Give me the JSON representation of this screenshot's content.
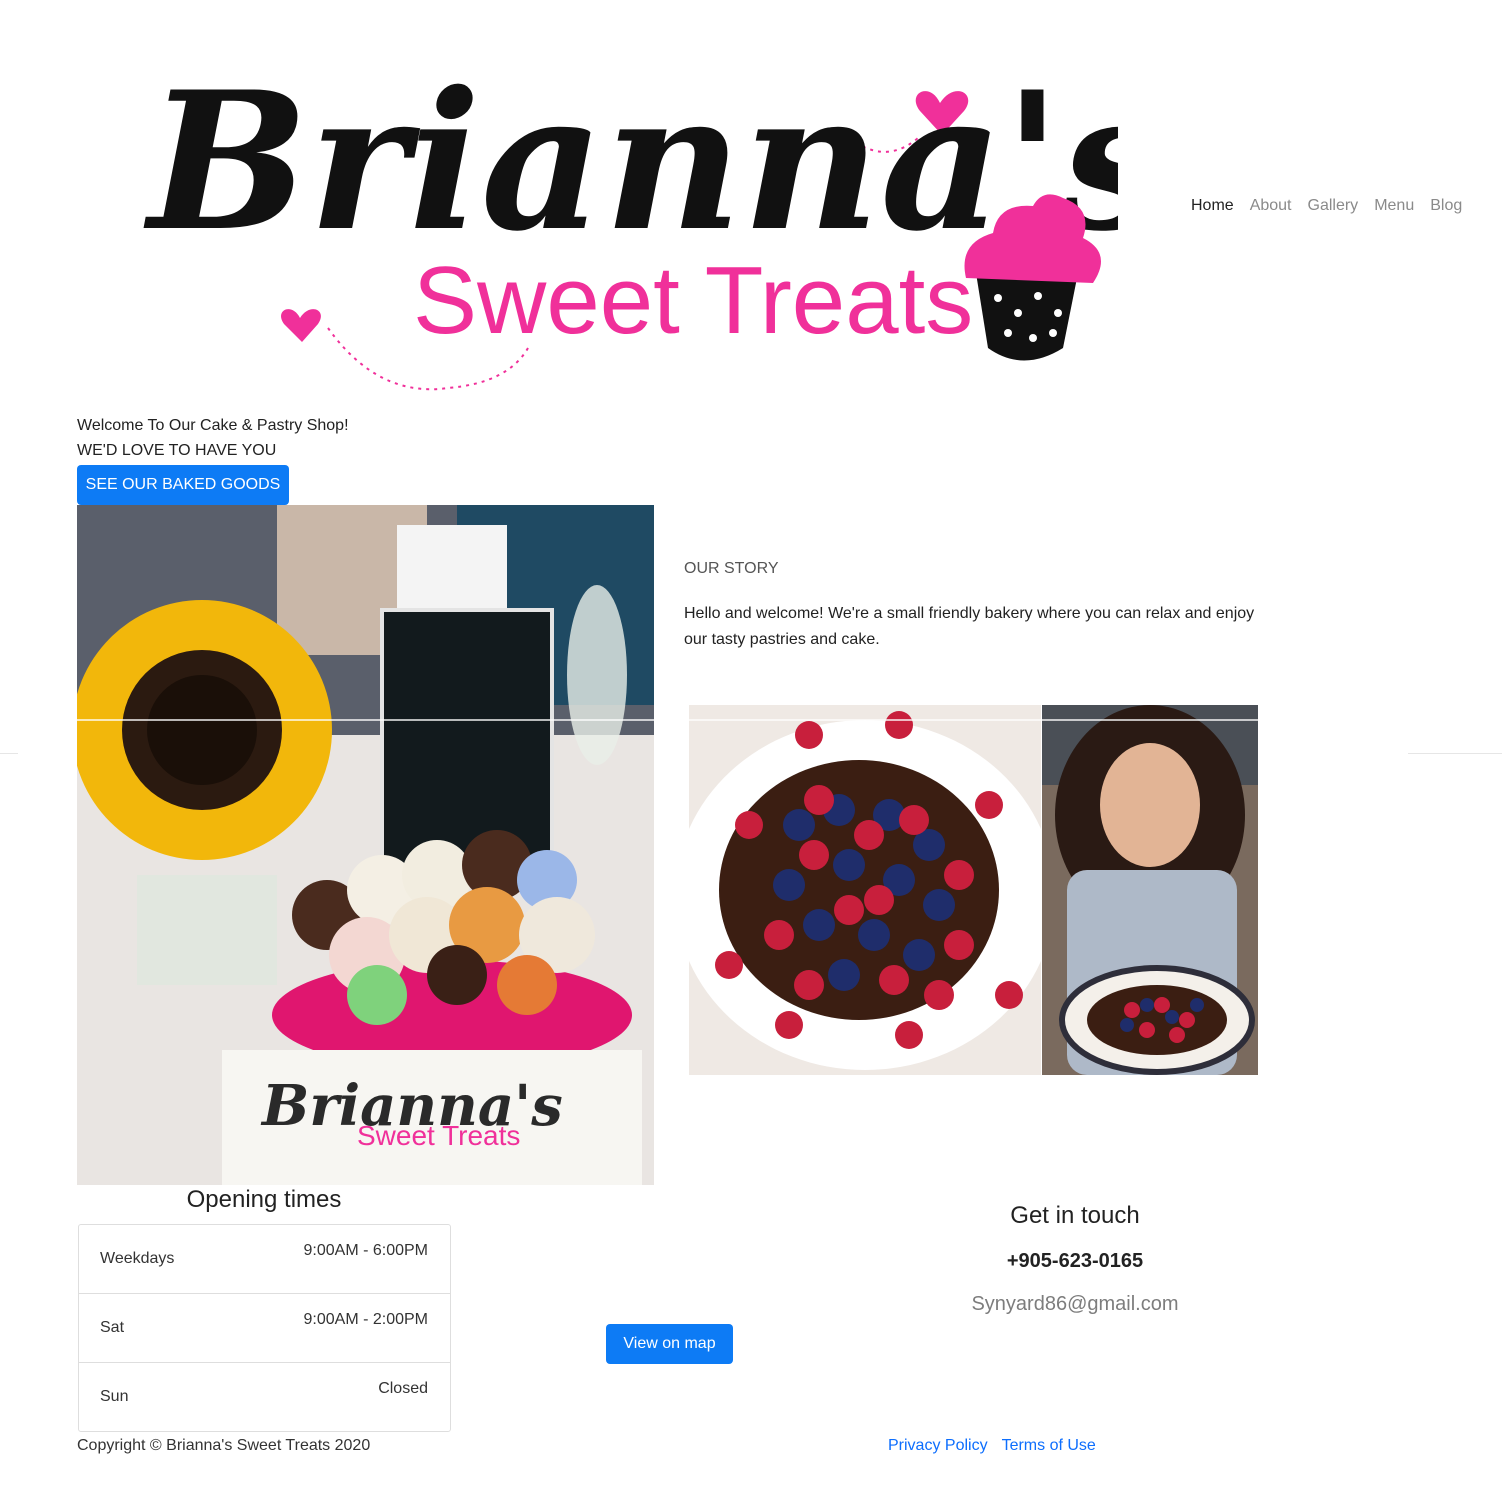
{
  "brand": {
    "logo_script": "Brianna's",
    "logo_sub": "Sweet Treats",
    "pink": "#f0309a"
  },
  "nav": {
    "items": [
      {
        "label": "Home",
        "active": true
      },
      {
        "label": "About"
      },
      {
        "label": "Gallery"
      },
      {
        "label": "Menu"
      },
      {
        "label": "Blog"
      }
    ]
  },
  "welcome": {
    "line1": "Welcome To Our Cake & Pastry Shop!",
    "line2": "WE'D LOVE TO HAVE YOU",
    "button": "SEE OUR BAKED GOODS"
  },
  "story": {
    "heading": "OUR STORY",
    "text": "Hello and welcome! We're a small friendly bakery where you can relax and enjoy our tasty pastries and cake."
  },
  "photos": {
    "table_card_script": "Brianna's",
    "table_card_sub": "Sweet Treats"
  },
  "hours": {
    "title": "Opening times",
    "rows": [
      {
        "day": "Weekdays",
        "time": "9:00AM - 6:00PM"
      },
      {
        "day": "Sat",
        "time": "9:00AM - 2:00PM"
      },
      {
        "day": "Sun",
        "time": "Closed"
      }
    ]
  },
  "map": {
    "button": "View on map"
  },
  "contact": {
    "title": "Get in touch",
    "phone": "+905-623-0165",
    "email": "Synyard86@gmail.com"
  },
  "footer": {
    "copyright": "Copyright © Brianna's Sweet Treats 2020",
    "links": [
      "Privacy Policy",
      "Terms of Use"
    ]
  },
  "colors": {
    "primary": "#0d7bf5",
    "link": "#0d6efd",
    "nav_muted": "#8a8a8a"
  }
}
